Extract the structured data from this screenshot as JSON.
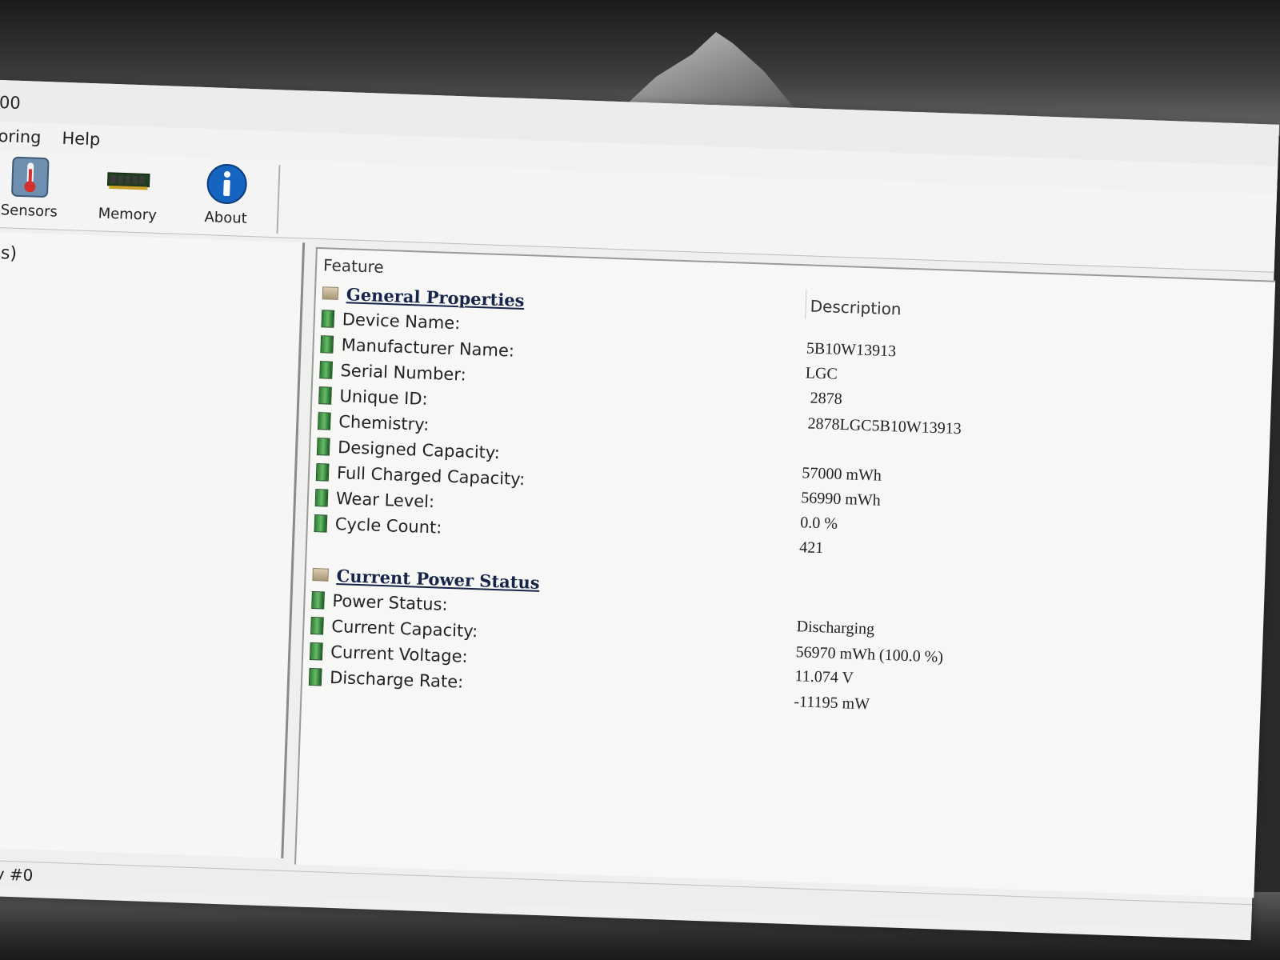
{
  "app": {
    "title": "00"
  },
  "menu": {
    "items": [
      "oring",
      "Help"
    ]
  },
  "window_controls": {
    "minimize": "—",
    "maximize": "☐",
    "close": "✕"
  },
  "toolbar": {
    "buttons": [
      {
        "label": "Sensors",
        "icon": "thermometer-icon"
      },
      {
        "label": "Memory",
        "icon": "memory-chip-icon"
      },
      {
        "label": "About",
        "icon": "info-icon"
      }
    ]
  },
  "left_pane": {
    "label": "(s)"
  },
  "columns": {
    "feature": "Feature",
    "description": "Description"
  },
  "general": {
    "title": "General Properties",
    "rows": [
      {
        "label": "Device Name:",
        "value": "5B10W13913"
      },
      {
        "label": "Manufacturer Name:",
        "value": "LGC"
      },
      {
        "label": "Serial Number:",
        "value": "2878"
      },
      {
        "label": "Unique ID:",
        "value": "2878LGC5B10W13913"
      },
      {
        "label": "Chemistry:",
        "value": ""
      },
      {
        "label": "Designed Capacity:",
        "value": "57000 mWh"
      },
      {
        "label": "Full Charged Capacity:",
        "value": "56990 mWh"
      },
      {
        "label": "Wear Level:",
        "value": "0.0 %"
      },
      {
        "label": "Cycle Count:",
        "value": "421"
      }
    ]
  },
  "power": {
    "title": "Current Power Status",
    "rows": [
      {
        "label": "Power Status:",
        "value": "Discharging"
      },
      {
        "label": "Current Capacity:",
        "value": "56970 mWh (100.0 %)"
      },
      {
        "label": "Current Voltage:",
        "value": "11.074 V"
      },
      {
        "label": "Discharge Rate:",
        "value": "-11195 mW"
      }
    ]
  },
  "status": {
    "text": "tery #0"
  }
}
